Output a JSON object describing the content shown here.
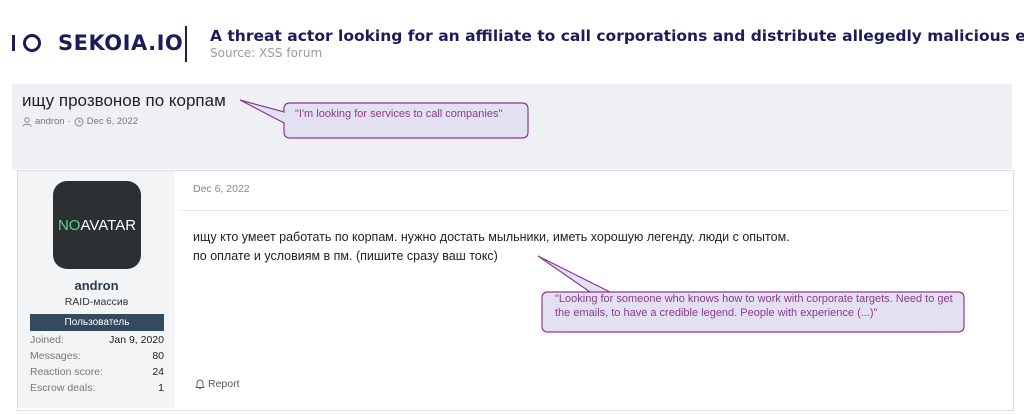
{
  "header": {
    "logo_text": "SEKOIA.IO",
    "title": "A threat actor looking for an affiliate to call corporations and distribute allegedly malicious emails",
    "source": "Source: XSS forum"
  },
  "thread": {
    "title": "ищу прозвонов по корпам",
    "author": "andron",
    "date": "Dec 6, 2022",
    "meta_separator": "·"
  },
  "post": {
    "date": "Dec 6, 2022",
    "line1": "ищу кто умеет работать по корпам. нужно достать мыльники, иметь хорошую легенду. люди с опытом.",
    "line2": "по оплате и условиям в пм. (пишите сразу ваш токс)",
    "report_label": "Report"
  },
  "user": {
    "avatar_no": "NO",
    "avatar_text": "AVATAR",
    "name": "andron",
    "title": "RAID-массив",
    "banner": "Пользователь",
    "stats": [
      {
        "label": "Joined:",
        "value": "Jan 9, 2020"
      },
      {
        "label": "Messages:",
        "value": "80"
      },
      {
        "label": "Reaction score:",
        "value": "24"
      },
      {
        "label": "Escrow deals:",
        "value": "1"
      }
    ]
  },
  "callouts": {
    "title_translation": "\"I'm looking for services to call companies\"",
    "post_translation": "\"Looking for someone who knows how to work with corporate targets. Need to get the emails, to have a credible legend. People with experience (...)\""
  },
  "colors": {
    "brand": "#1c1c5a",
    "callout_border": "#8b3a8f",
    "callout_fill": "#e3e1f1",
    "banner": "#344a5e",
    "avatar_bg": "#2b3033",
    "avatar_green": "#63d08a"
  }
}
